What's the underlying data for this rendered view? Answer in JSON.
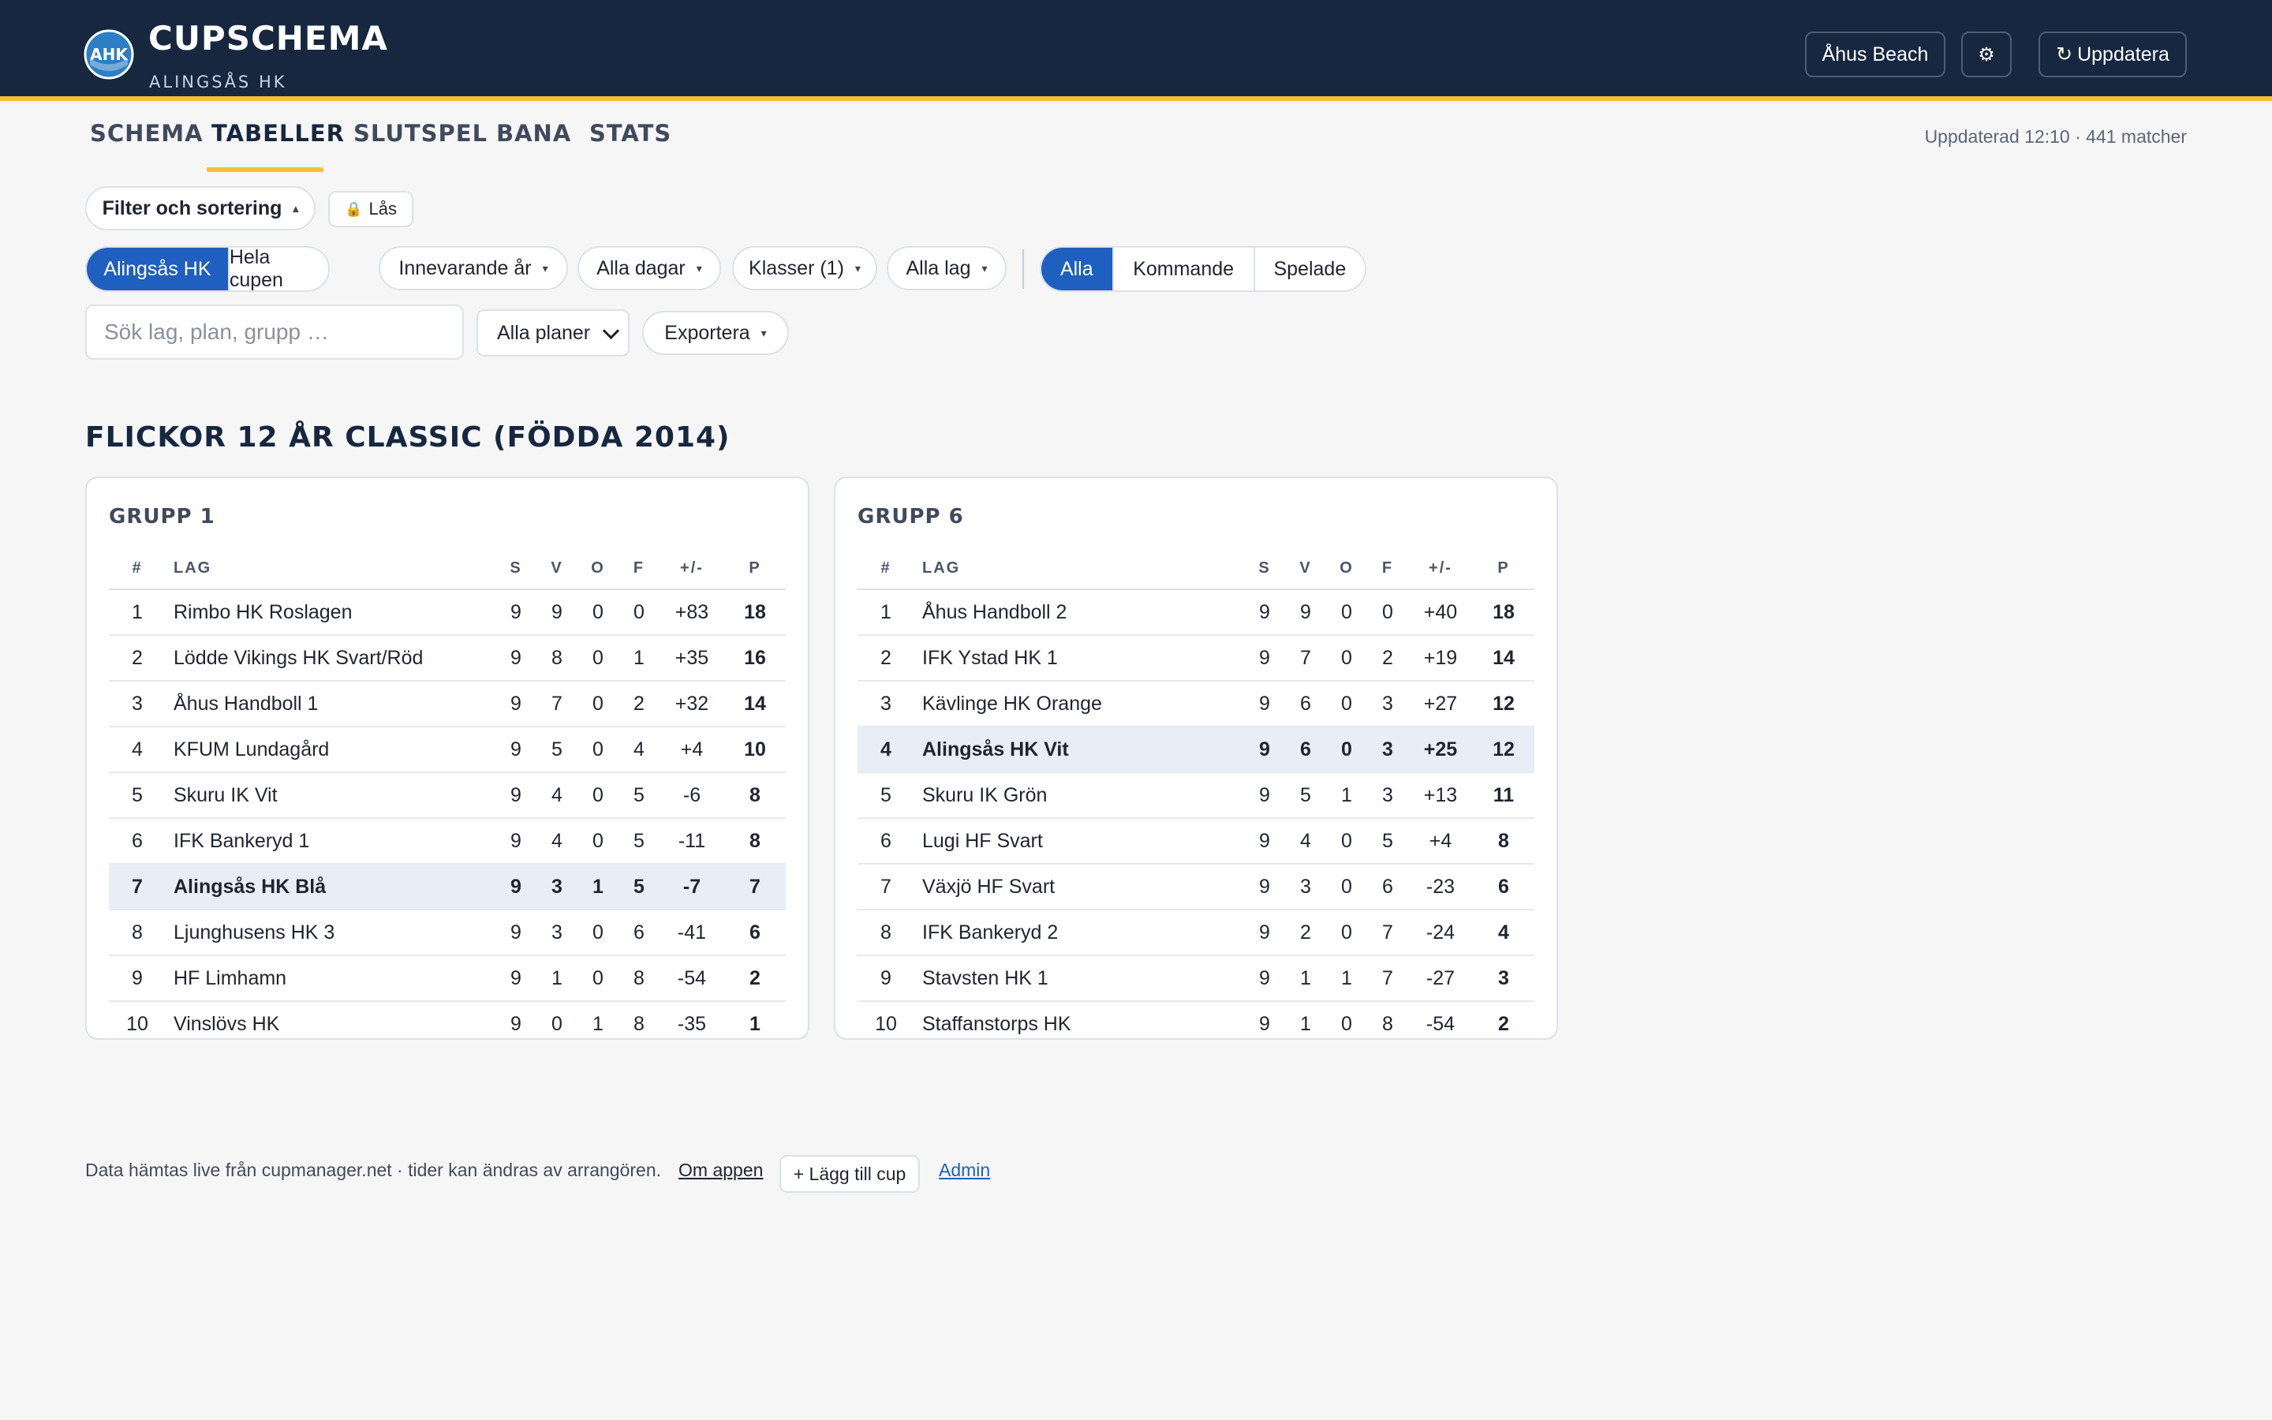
{
  "header": {
    "title": "CUPSCHEMA",
    "subtitle": "ALINGSÅS HK",
    "logo_text": "AHK",
    "cup_button": "Åhus Beach",
    "settings_icon": "gear-icon",
    "refresh_icon": "refresh-icon",
    "refresh_label": "Uppdatera",
    "colors": {
      "bar": "#16273f",
      "accent": "#f1c232",
      "primary": "#1f5fbf"
    }
  },
  "nav": {
    "tabs": [
      {
        "label": "SCHEMA"
      },
      {
        "label": "TABELLER",
        "active": true
      },
      {
        "label": "SLUTSPEL"
      },
      {
        "label": "BANA"
      },
      {
        "label": "STATS"
      }
    ],
    "updated": "Uppdaterad 12:10 · 441 matcher"
  },
  "controls": {
    "filter_label": "Filter och sortering",
    "lock_label": "Lås",
    "scope": [
      "Alingsås HK",
      "Hela cupen"
    ],
    "year": "Innevarande år",
    "days": "Alla dagar",
    "classes": "Klasser (1)",
    "teams": "Alla lag",
    "status": [
      "Alla",
      "Kommande",
      "Spelade"
    ],
    "search_placeholder": "Sök lag, plan, grupp …",
    "pitch": "Alla planer",
    "export": "Exportera"
  },
  "section": {
    "title": "FLICKOR 12 ÅR CLASSIC (FÖDDA 2014)"
  },
  "columns": [
    "#",
    "LAG",
    "S",
    "V",
    "O",
    "F",
    "+/-",
    "P"
  ],
  "groups": [
    {
      "title": "GRUPP 1",
      "rows": [
        {
          "pos": "1",
          "team": "Rimbo HK Roslagen",
          "s": "9",
          "v": "9",
          "o": "0",
          "f": "0",
          "gd": "+83",
          "p": "18"
        },
        {
          "pos": "2",
          "team": "Lödde Vikings HK Svart/Röd",
          "s": "9",
          "v": "8",
          "o": "0",
          "f": "1",
          "gd": "+35",
          "p": "16"
        },
        {
          "pos": "3",
          "team": "Åhus Handboll 1",
          "s": "9",
          "v": "7",
          "o": "0",
          "f": "2",
          "gd": "+32",
          "p": "14"
        },
        {
          "pos": "4",
          "team": "KFUM Lundagård",
          "s": "9",
          "v": "5",
          "o": "0",
          "f": "4",
          "gd": "+4",
          "p": "10"
        },
        {
          "pos": "5",
          "team": "Skuru IK Vit",
          "s": "9",
          "v": "4",
          "o": "0",
          "f": "5",
          "gd": "-6",
          "p": "8"
        },
        {
          "pos": "6",
          "team": "IFK Bankeryd 1",
          "s": "9",
          "v": "4",
          "o": "0",
          "f": "5",
          "gd": "-11",
          "p": "8"
        },
        {
          "pos": "7",
          "team": "Alingsås HK Blå",
          "s": "9",
          "v": "3",
          "o": "1",
          "f": "5",
          "gd": "-7",
          "p": "7",
          "highlight": true
        },
        {
          "pos": "8",
          "team": "Ljunghusens HK 3",
          "s": "9",
          "v": "3",
          "o": "0",
          "f": "6",
          "gd": "-41",
          "p": "6"
        },
        {
          "pos": "9",
          "team": "HF Limhamn",
          "s": "9",
          "v": "1",
          "o": "0",
          "f": "8",
          "gd": "-54",
          "p": "2"
        },
        {
          "pos": "10",
          "team": "Vinslövs HK",
          "s": "9",
          "v": "0",
          "o": "1",
          "f": "8",
          "gd": "-35",
          "p": "1"
        }
      ]
    },
    {
      "title": "GRUPP 6",
      "rows": [
        {
          "pos": "1",
          "team": "Åhus Handboll 2",
          "s": "9",
          "v": "9",
          "o": "0",
          "f": "0",
          "gd": "+40",
          "p": "18"
        },
        {
          "pos": "2",
          "team": "IFK Ystad HK 1",
          "s": "9",
          "v": "7",
          "o": "0",
          "f": "2",
          "gd": "+19",
          "p": "14"
        },
        {
          "pos": "3",
          "team": "Kävlinge HK Orange",
          "s": "9",
          "v": "6",
          "o": "0",
          "f": "3",
          "gd": "+27",
          "p": "12"
        },
        {
          "pos": "4",
          "team": "Alingsås HK Vit",
          "s": "9",
          "v": "6",
          "o": "0",
          "f": "3",
          "gd": "+25",
          "p": "12",
          "highlight": true
        },
        {
          "pos": "5",
          "team": "Skuru IK Grön",
          "s": "9",
          "v": "5",
          "o": "1",
          "f": "3",
          "gd": "+13",
          "p": "11"
        },
        {
          "pos": "6",
          "team": "Lugi HF Svart",
          "s": "9",
          "v": "4",
          "o": "0",
          "f": "5",
          "gd": "+4",
          "p": "8"
        },
        {
          "pos": "7",
          "team": "Växjö HF Svart",
          "s": "9",
          "v": "3",
          "o": "0",
          "f": "6",
          "gd": "-23",
          "p": "6"
        },
        {
          "pos": "8",
          "team": "IFK Bankeryd 2",
          "s": "9",
          "v": "2",
          "o": "0",
          "f": "7",
          "gd": "-24",
          "p": "4"
        },
        {
          "pos": "9",
          "team": "Stavsten HK 1",
          "s": "9",
          "v": "1",
          "o": "1",
          "f": "7",
          "gd": "-27",
          "p": "3"
        },
        {
          "pos": "10",
          "team": "Staffanstorps HK",
          "s": "9",
          "v": "1",
          "o": "0",
          "f": "8",
          "gd": "-54",
          "p": "2"
        }
      ]
    }
  ],
  "footer": {
    "text": "Data hämtas live från cupmanager.net · tider kan ändras av arrangören.",
    "about": "Om appen",
    "add_cup": "+ Lägg till cup",
    "admin": "Admin"
  }
}
